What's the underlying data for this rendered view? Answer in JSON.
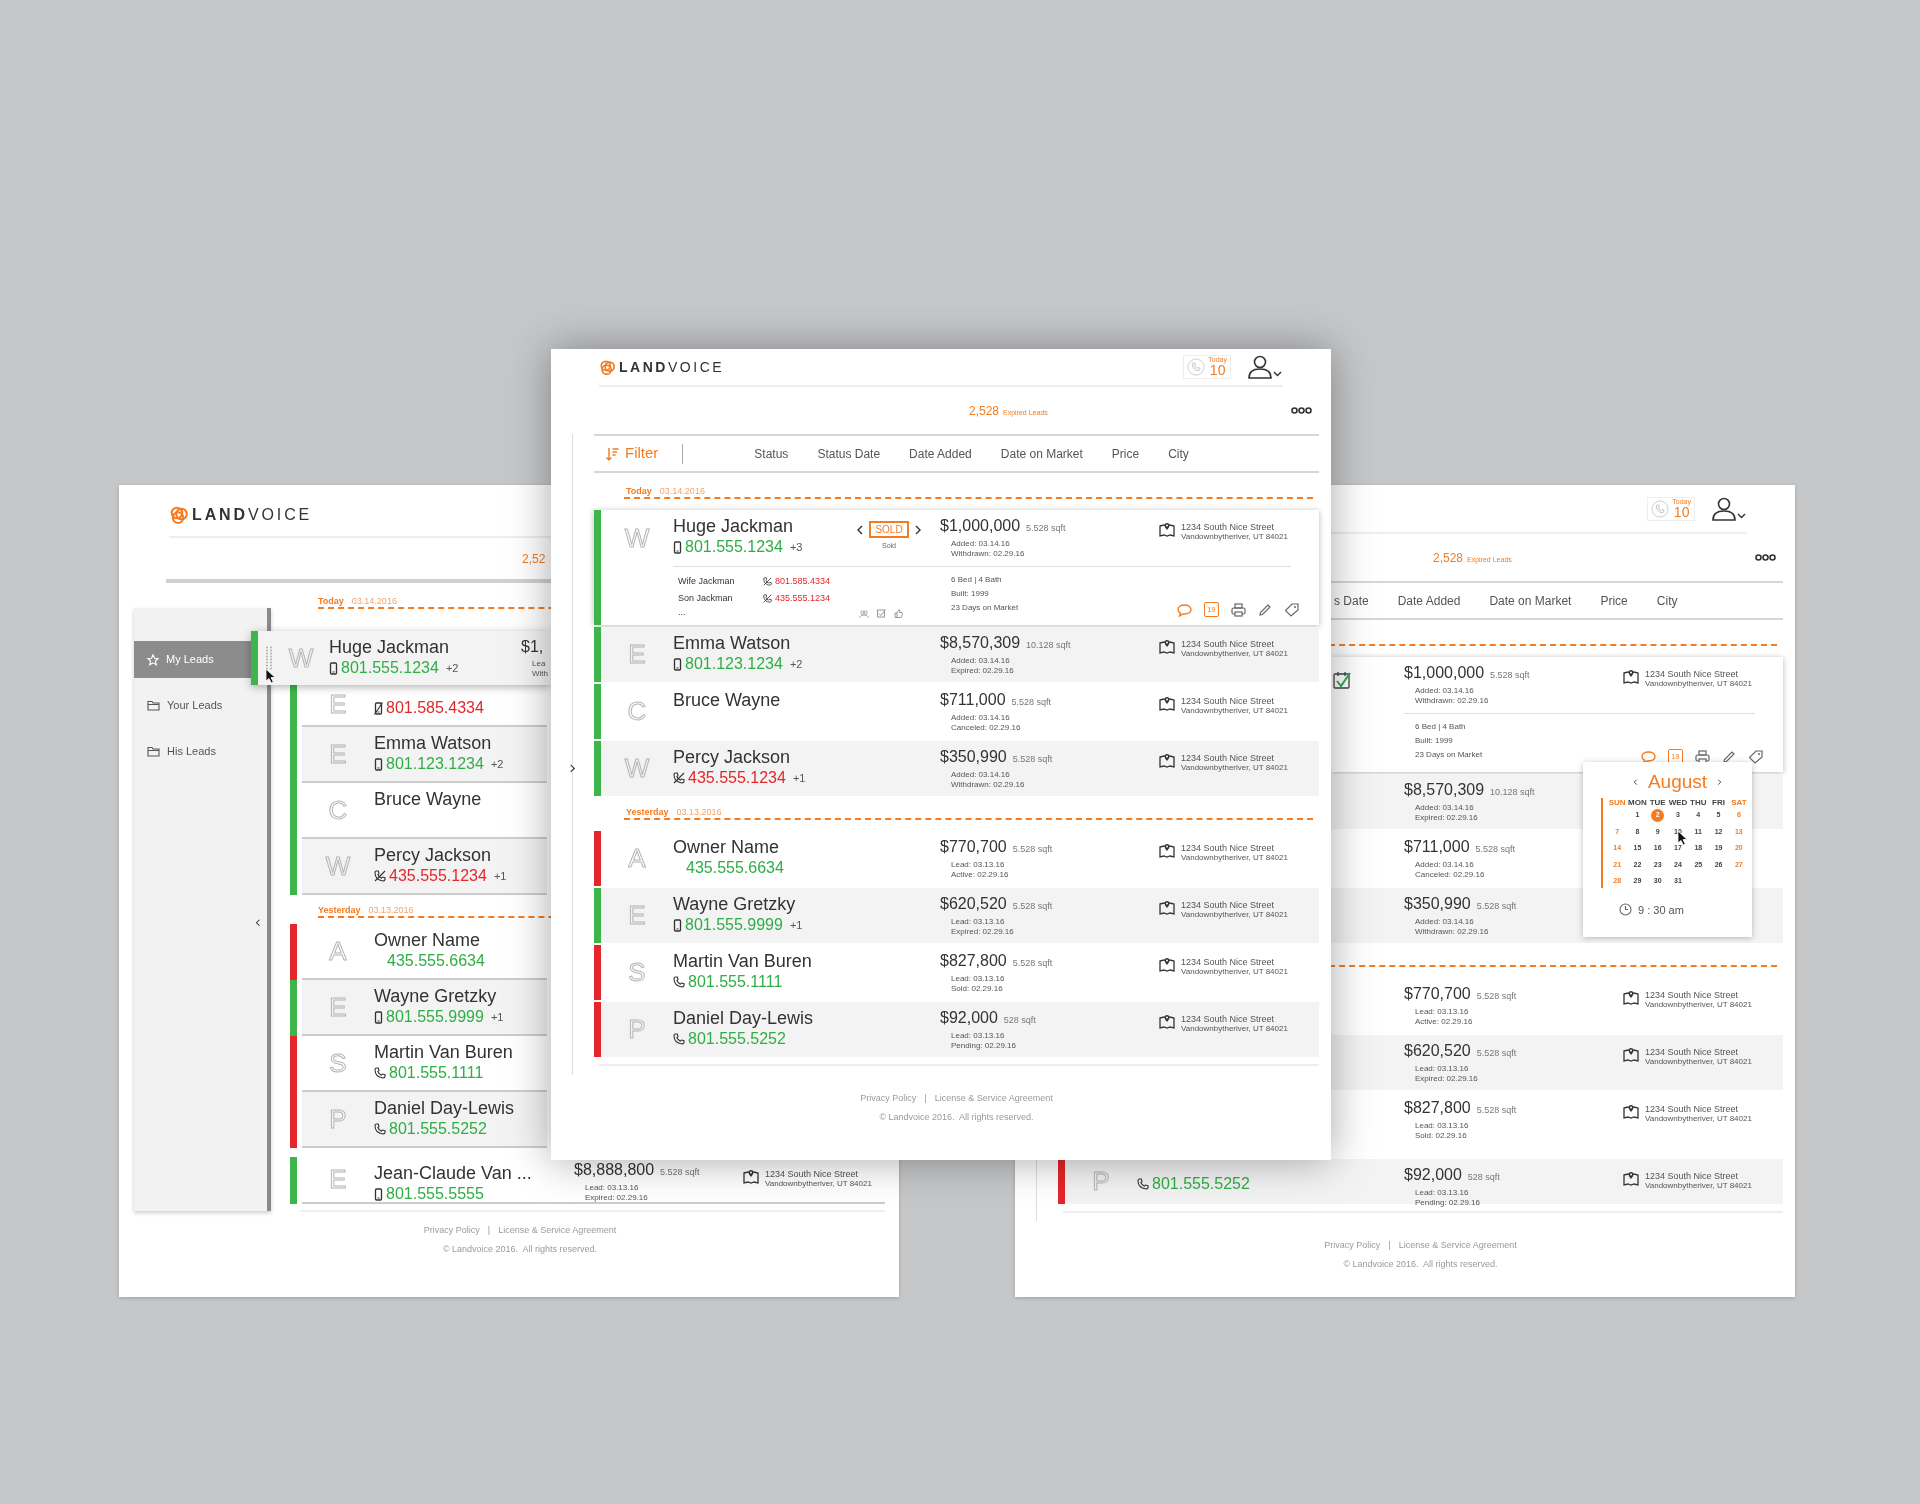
{
  "left_screen": {
    "logo": "**LAND**VOICE",
    "expired_count": "2,52",
    "sidebar": [
      {
        "label": "My Leads",
        "kind": "star",
        "selected": true
      },
      {
        "label": "Your Leads",
        "kind": "folder",
        "selected": false
      },
      {
        "label": "His Leads",
        "kind": "folder",
        "selected": false
      }
    ],
    "dragged_row": {
      "letter": "W",
      "name": "Huge Jackman",
      "phone": "801.555.1234",
      "kind": "mobile",
      "blocked": false,
      "extra": "+2",
      "price": "$1,",
      "dates": [
        "Lea",
        "With"
      ],
      "color": "#3db54a"
    },
    "groups": [
      {
        "label": "Today",
        "date": "03.14.2016",
        "rows": [
          {
            "letter": "E",
            "phone": "801.585.4334",
            "kind": "mobile",
            "blocked": true,
            "color": "#3db54a"
          },
          {
            "letter": "E",
            "name": "Emma Watson",
            "phone": "801.123.1234",
            "kind": "mobile",
            "blocked": false,
            "extra": "+2",
            "color": "#3db54a"
          },
          {
            "letter": "C",
            "name": "Bruce Wayne",
            "color": "#3db54a"
          },
          {
            "letter": "W",
            "name": "Percy Jackson",
            "phone": "435.555.1234",
            "kind": "landline",
            "blocked": true,
            "extra": "+1",
            "color": "#3db54a"
          }
        ]
      },
      {
        "label": "Yesterday",
        "date": "03.13.2016",
        "rows": [
          {
            "letter": "A",
            "name": "Owner Name",
            "phone": "435.555.6634",
            "kind": "none",
            "blocked": false,
            "color": "#e5262a"
          },
          {
            "letter": "E",
            "name": "Wayne Gretzky",
            "phone": "801.555.9999",
            "kind": "mobile",
            "blocked": false,
            "extra": "+1",
            "color": "#3db54a"
          },
          {
            "letter": "S",
            "name": "Martin Van Buren",
            "phone": "801.555.1111",
            "kind": "landline",
            "blocked": false,
            "color": "#e5262a"
          },
          {
            "letter": "P",
            "name": "Daniel Day-Lewis",
            "phone": "801.555.5252",
            "kind": "landline",
            "blocked": false,
            "color": "#e5262a"
          },
          {
            "letter": "E",
            "name": "Jean-Claude Van ...",
            "phone": "801.555.5555",
            "kind": "mobile",
            "blocked": false,
            "color": "#3db54a",
            "price": "$8,888,800",
            "sqft": "5.528 sqft",
            "dates": [
              "Lead: 03.13.16",
              "Expired: 02.29.16"
            ],
            "address": [
              "1234 South Nice Street",
              "Vandownbytheriver, UT 84021"
            ]
          }
        ]
      }
    ],
    "footer": {
      "links": [
        "Privacy Policy",
        "License & Service Agreement"
      ],
      "separator": "|",
      "copyright": "© Landvoice 2016.  All rights reserved."
    }
  },
  "center_screen": {
    "logo": "**LAND**VOICE",
    "calls": {
      "label": "Today",
      "count": "10"
    },
    "expired": {
      "count": "2,528",
      "label": "Expired Leads"
    },
    "filter_label": "Filter",
    "columns": [
      "Status",
      "Status Date",
      "Date Added",
      "Date on Market",
      "Price",
      "City"
    ],
    "groups": [
      {
        "label": "Today",
        "date": "03.14.2016",
        "rows": [
          {
            "expanded": true,
            "letter": "W",
            "name": "Huge Jackman",
            "phone": "801.555.1234",
            "kind": "mobile",
            "blocked": false,
            "extra": "+3",
            "status": {
              "kind": "badge",
              "label": "SOLD",
              "caption": "Sold"
            },
            "price": "$1,000,000",
            "sqft": "5.528 sqft",
            "dates": [
              "Added: 03.14.16",
              "Withdrawn: 02.29.16"
            ],
            "address": [
              "1234 South Nice Street",
              "Vandownbytheriver, UT 84021"
            ],
            "color": "#3db54a",
            "contacts": [
              {
                "name": "Wife Jackman",
                "phone": "801.585.4334",
                "kind": "landline",
                "blocked": true
              },
              {
                "name": "Son Jackman",
                "phone": "435.555.1234",
                "kind": "landline",
                "blocked": true
              }
            ],
            "more": "...",
            "details": [
              "6 Bed | 4 Bath",
              "Built: 1999",
              "23 Days on Market"
            ],
            "calendar_day": "19"
          },
          {
            "expanded": false,
            "letter": "E",
            "name": "Emma Watson",
            "phone": "801.123.1234",
            "kind": "mobile",
            "blocked": false,
            "extra": "+2",
            "price": "$8,570,309",
            "sqft": "10.128 sqft",
            "dates": [
              "Added: 03.14.16",
              "Expired: 02.29.16"
            ],
            "address": [
              "1234 South Nice Street",
              "Vandownbytheriver, UT 84021"
            ],
            "color": "#3db54a"
          },
          {
            "expanded": false,
            "letter": "C",
            "name": "Bruce Wayne",
            "price": "$711,000",
            "sqft": "5.528 sqft",
            "dates": [
              "Added: 03.14.16",
              "Canceled: 02.29.16"
            ],
            "address": [
              "1234 South Nice Street",
              "Vandownbytheriver, UT 84021"
            ],
            "color": "#3db54a"
          },
          {
            "expanded": false,
            "letter": "W",
            "name": "Percy Jackson",
            "phone": "435.555.1234",
            "kind": "landline",
            "blocked": true,
            "extra": "+1",
            "price": "$350,990",
            "sqft": "5.528 sqft",
            "dates": [
              "Added: 03.14.16",
              "Withdrawn: 02.29.16"
            ],
            "address": [
              "1234 South Nice Street",
              "Vandownbytheriver, UT 84021"
            ],
            "color": "#3db54a"
          }
        ]
      },
      {
        "label": "Yesterday",
        "date": "03.13.2016",
        "rows": [
          {
            "expanded": false,
            "letter": "A",
            "name": "Owner Name",
            "phone": "435.555.6634",
            "kind": "none",
            "blocked": false,
            "price": "$770,700",
            "sqft": "5.528 sqft",
            "dates": [
              "Lead: 03.13.16",
              "Active: 02.29.16"
            ],
            "address": [
              "1234 South Nice Street",
              "Vandownbytheriver, UT 84021"
            ],
            "color": "#e5262a"
          },
          {
            "expanded": false,
            "letter": "E",
            "name": "Wayne Gretzky",
            "phone": "801.555.9999",
            "kind": "mobile",
            "blocked": false,
            "extra": "+1",
            "price": "$620,520",
            "sqft": "5.528 sqft",
            "dates": [
              "Lead: 03.13.16",
              "Expired: 02.29.16"
            ],
            "address": [
              "1234 South Nice Street",
              "Vandownbytheriver, UT 84021"
            ],
            "color": "#3db54a"
          },
          {
            "expanded": false,
            "letter": "S",
            "name": "Martin Van Buren",
            "phone": "801.555.1111",
            "kind": "landline",
            "blocked": false,
            "price": "$827,800",
            "sqft": "5.528 sqft",
            "dates": [
              "Lead: 03.13.16",
              "Sold: 02.29.16"
            ],
            "address": [
              "1234 South Nice Street",
              "Vandownbytheriver, UT 84021"
            ],
            "color": "#e5262a"
          },
          {
            "expanded": false,
            "letter": "P",
            "name": "Daniel Day-Lewis",
            "phone": "801.555.5252",
            "kind": "landline",
            "blocked": false,
            "price": "$92,000",
            "sqft": "528 sqft",
            "dates": [
              "Lead: 03.13.16",
              "Pending: 02.29.16"
            ],
            "address": [
              "1234 South Nice Street",
              "Vandownbytheriver, UT 84021"
            ],
            "color": "#e5262a"
          }
        ]
      }
    ],
    "footer": {
      "links": [
        "Privacy Policy",
        "License & Service Agreement"
      ],
      "separator": "|",
      "copyright": "© Landvoice 2016.  All rights reserved."
    }
  },
  "right_screen": {
    "calls": {
      "label": "Today",
      "count": "10"
    },
    "expired": {
      "count": "2,528",
      "label": "Expired Leads"
    },
    "columns": [
      "s Date",
      "Date Added",
      "Date on Market",
      "Price",
      "City"
    ],
    "groups": [
      {
        "rows": [
          {
            "expanded": true,
            "status": {
              "kind": "checked"
            },
            "price": "$1,000,000",
            "sqft": "5.528 sqft",
            "dates": [
              "Added: 03.14.16",
              "Withdrawn: 02.29.16"
            ],
            "address": [
              "1234 South Nice Street",
              "Vandownbytheriver, UT 84021"
            ],
            "details": [
              "6 Bed | 4 Bath",
              "Built: 1999",
              "23 Days on Market"
            ],
            "calendar_day": "19"
          },
          {
            "expanded": false,
            "price": "$8,570,309",
            "sqft": "10.128 sqft",
            "dates": [
              "Added: 03.14.16",
              "Expired: 02.29.16"
            ]
          },
          {
            "expanded": false,
            "price": "$711,000",
            "sqft": "5.528 sqft",
            "dates": [
              "Added: 03.14.16",
              "Canceled: 02.29.16"
            ]
          },
          {
            "expanded": false,
            "price": "$350,990",
            "sqft": "5.528 sqft",
            "dates": [
              "Added: 03.14.16",
              "Withdrawn: 02.29.16"
            ]
          }
        ]
      },
      {
        "rows": [
          {
            "expanded": false,
            "price": "$770,700",
            "sqft": "5.528 sqft",
            "dates": [
              "Lead: 03.13.16",
              "Active: 02.29.16"
            ],
            "address": [
              "1234 South Nice Street",
              "Vandownbytheriver, UT 84021"
            ]
          },
          {
            "expanded": false,
            "price": "$620,520",
            "sqft": "5.528 sqft",
            "dates": [
              "Lead: 03.13.16",
              "Expired: 02.29.16"
            ],
            "address": [
              "1234 South Nice Street",
              "Vandownbytheriver, UT 84021"
            ]
          },
          {
            "expanded": false,
            "price": "$827,800",
            "sqft": "5.528 sqft",
            "dates": [
              "Lead: 03.13.16",
              "Sold: 02.29.16"
            ],
            "address": [
              "1234 South Nice Street",
              "Vandownbytheriver, UT 84021"
            ]
          },
          {
            "expanded": false,
            "letter": "P",
            "phone": "801.555.5252",
            "kind": "landline",
            "blocked": false,
            "price": "$92,000",
            "sqft": "528 sqft",
            "dates": [
              "Lead: 03.13.16",
              "Pending: 02.29.16"
            ],
            "address": [
              "1234 South Nice Street",
              "Vandownbytheriver, UT 84021"
            ],
            "color": "#e5262a"
          }
        ]
      }
    ],
    "calendar": {
      "month": "August",
      "weekdays": [
        "SUN",
        "MON",
        "TUE",
        "WED",
        "THU",
        "FRI",
        "SAT"
      ],
      "weeks": [
        [
          {
            "day": "1",
            "selected": false
          },
          {
            "day": "2",
            "selected": true
          },
          {
            "day": "3",
            "selected": false
          },
          {
            "day": "4",
            "selected": false
          },
          {
            "day": "5",
            "selected": false
          },
          {
            "day": "6",
            "selected": false
          }
        ],
        [
          {
            "day": "7",
            "selected": false
          },
          {
            "day": "8",
            "selected": false
          },
          {
            "day": "9",
            "selected": false
          },
          {
            "day": "10",
            "selected": false
          },
          {
            "day": "11",
            "selected": false
          },
          {
            "day": "12",
            "selected": false
          },
          {
            "day": "13",
            "selected": false
          }
        ],
        [
          {
            "day": "14",
            "selected": false
          },
          {
            "day": "15",
            "selected": false
          },
          {
            "day": "16",
            "selected": false
          },
          {
            "day": "17",
            "selected": false
          },
          {
            "day": "18",
            "selected": false
          },
          {
            "day": "19",
            "selected": false
          },
          {
            "day": "20",
            "selected": false
          }
        ],
        [
          {
            "day": "21",
            "selected": false
          },
          {
            "day": "22",
            "selected": false
          },
          {
            "day": "23",
            "selected": false
          },
          {
            "day": "24",
            "selected": false
          },
          {
            "day": "25",
            "selected": false
          },
          {
            "day": "26",
            "selected": false
          },
          {
            "day": "27",
            "selected": false
          }
        ],
        [
          {
            "day": "28",
            "selected": false
          },
          {
            "day": "29",
            "selected": false
          },
          {
            "day": "30",
            "selected": false
          },
          {
            "day": "31",
            "selected": false
          }
        ]
      ],
      "time": "9 : 30 am"
    },
    "footer": {
      "links": [
        "Privacy Policy",
        "License & Service Agreement"
      ],
      "separator": "|",
      "copyright": "© Landvoice 2016.  All rights reserved."
    }
  }
}
